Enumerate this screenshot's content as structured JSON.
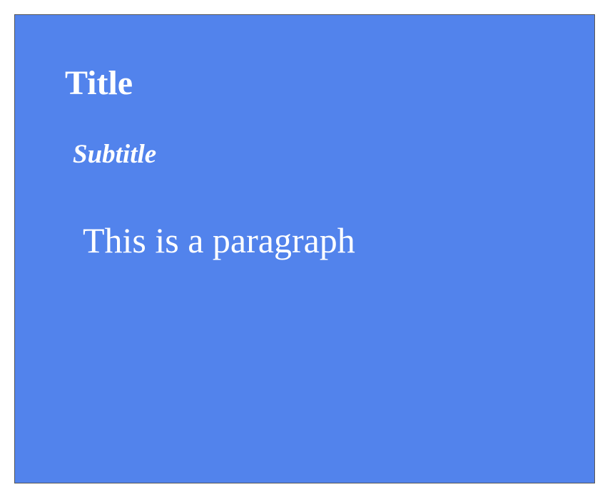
{
  "slide": {
    "background_color": "#5283ec",
    "text_color": "#ffffff",
    "title": "Title",
    "subtitle": "Subtitle",
    "paragraph": "This is a paragraph"
  }
}
